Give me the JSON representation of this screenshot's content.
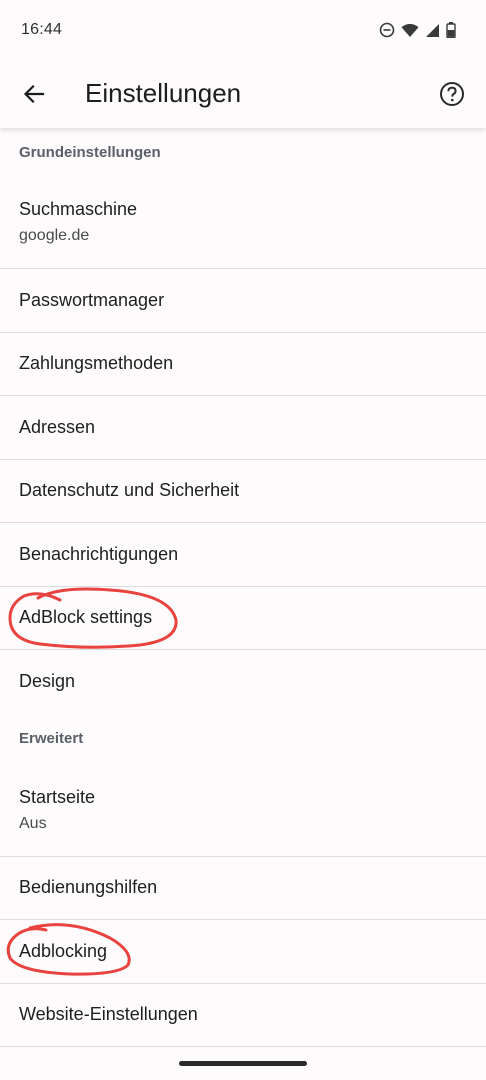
{
  "status_bar": {
    "time": "16:44"
  },
  "app_bar": {
    "title": "Einstellungen"
  },
  "sections": [
    {
      "header": "Grundeinstellungen",
      "items": [
        {
          "title": "Suchmaschine",
          "subtitle": "google.de"
        },
        {
          "title": "Passwortmanager"
        },
        {
          "title": "Zahlungsmethoden"
        },
        {
          "title": "Adressen"
        },
        {
          "title": "Datenschutz und Sicherheit"
        },
        {
          "title": "Benachrichtigungen"
        },
        {
          "title": "AdBlock settings"
        },
        {
          "title": "Design"
        }
      ]
    },
    {
      "header": "Erweitert",
      "items": [
        {
          "title": "Startseite",
          "subtitle": "Aus"
        },
        {
          "title": "Bedienungshilfen"
        },
        {
          "title": "Adblocking"
        },
        {
          "title": "Website-Einstellungen"
        }
      ]
    }
  ],
  "annotation_color": "#e8433f"
}
